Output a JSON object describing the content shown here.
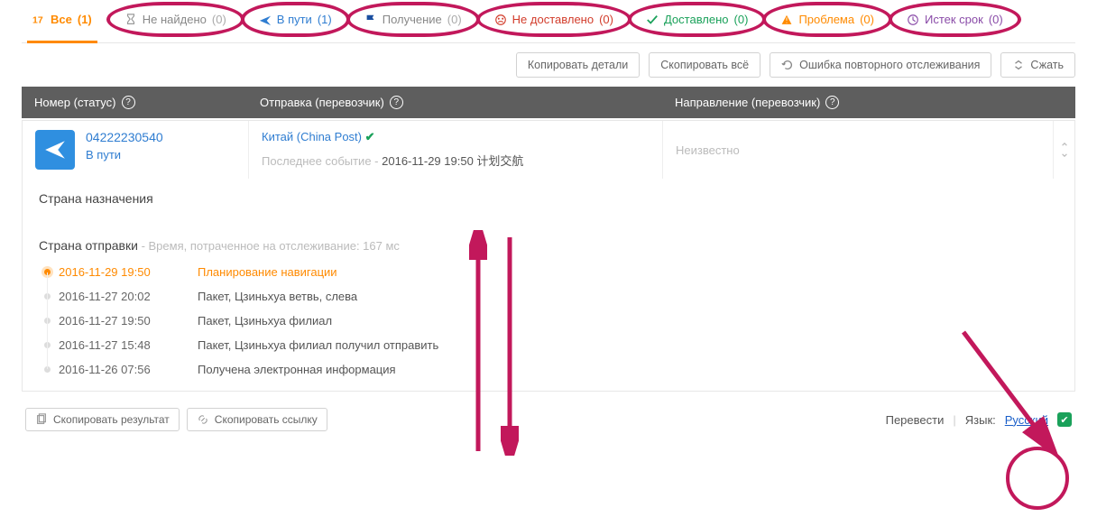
{
  "tabs": {
    "all": {
      "label": "Все",
      "count": "(1)"
    },
    "notfound": {
      "label": "Не найдено",
      "count": "(0)"
    },
    "intransit": {
      "label": "В пути",
      "count": "(1)"
    },
    "pickup": {
      "label": "Получение",
      "count": "(0)"
    },
    "undelivered": {
      "label": "Не доставлено",
      "count": "(0)"
    },
    "delivered": {
      "label": "Доставлено",
      "count": "(0)"
    },
    "problem": {
      "label": "Проблема",
      "count": "(0)"
    },
    "expired": {
      "label": "Истек срок",
      "count": "(0)"
    }
  },
  "toolbar": {
    "copy_details": "Копировать детали",
    "copy_all": "Скопировать всё",
    "retrack": "Ошибка повторного отслеживания",
    "collapse": "Сжать"
  },
  "header": {
    "number": "Номер (статус)",
    "shipment": "Отправка (перевозчик)",
    "direction": "Направление (перевозчик)"
  },
  "shipment": {
    "number": "04222230540",
    "status": "В пути",
    "carrier": "Китай (China Post)",
    "last_event_label": "Последнее событие -",
    "last_event_value": "2016-11-29 19:50 计划交航",
    "direction": "Неизвестно"
  },
  "details": {
    "dest_country_label": "Страна назначения",
    "origin_country_label": "Страна отправки",
    "timing_note": "- Время, потраченное на отслеживание: 167 мс",
    "events": [
      {
        "date": "2016-11-29 19:50",
        "text": "Планирование навигации"
      },
      {
        "date": "2016-11-27 20:02",
        "text": "Пакет, Цзиньхуа ветвь, слева"
      },
      {
        "date": "2016-11-27 19:50",
        "text": "Пакет, Цзиньхуа филиал"
      },
      {
        "date": "2016-11-27 15:48",
        "text": "Пакет, Цзиньхуа филиал получил отправить"
      },
      {
        "date": "2016-11-26 07:56",
        "text": "Получена электронная информация"
      }
    ]
  },
  "footer": {
    "copy_result": "Скопировать результат",
    "copy_link": "Скопировать ссылку",
    "translate": "Перевести",
    "language_label": "Язык:",
    "language_value": "Русский"
  }
}
